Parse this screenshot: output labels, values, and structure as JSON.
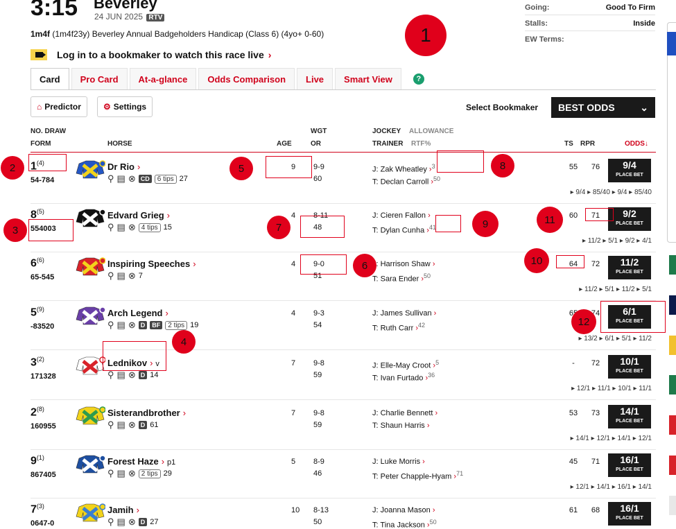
{
  "race": {
    "time": "3:15",
    "course": "Beverley",
    "date": "24 JUN 2025",
    "rtv": "RTV",
    "distance": "1m4f",
    "detail": " (1m4f23y) Beverley Annual Badgeholders Handicap (Class 6) (4yo+ 0-60)",
    "watch_text": "Log in to a bookmaker to watch this race live",
    "going_label": "Going:",
    "going_value": "Good To Firm",
    "stalls_label": "Stalls:",
    "stalls_value": "Inside",
    "ew_label": "EW Terms:",
    "chevron": "›"
  },
  "tabs": [
    "Card",
    "Pro Card",
    "At-a-glance",
    "Odds Comparison",
    "Live",
    "Smart View"
  ],
  "help": "?",
  "toolbar": {
    "predictor": "Predictor",
    "settings": "Settings",
    "select_label": "Select Bookmaker",
    "bookmaker": "BEST ODDS"
  },
  "columns": {
    "no_draw": "NO.  DRAW",
    "form": "FORM",
    "horse": "HORSE",
    "age": "AGE",
    "wgt": "WGT",
    "or": "OR",
    "jockey": "JOCKEY",
    "allowance": "ALLOWANCE",
    "trainer": "TRAINER",
    "rtf": "RTF%",
    "ts": "TS",
    "rpr": "RPR",
    "odds": "ODDS↓"
  },
  "place_bet": "PLACE BET",
  "runners": [
    {
      "no": "1",
      "draw": "(4)",
      "form": "54-784",
      "horse": "Dr Rio",
      "headgear": "",
      "badges": [
        "CD"
      ],
      "tips": "6 tips",
      "days": "27",
      "age": "9",
      "wgt": "9-9",
      "or": "60",
      "jockey": "J: Zak Wheatley",
      "allow": "3",
      "trainer": "T: Declan Carroll",
      "rtf": "50",
      "ts": "55",
      "rpr": "76",
      "odds": "9/4",
      "hist": "▸ 9/4  ▸ 85/40  ▸ 9/4  ▸ 85/40",
      "silk": [
        "#2457c5",
        "#f2d31b"
      ]
    },
    {
      "no": "8",
      "draw": "(5)",
      "form": "554003",
      "horse": "Edvard Grieg",
      "headgear": "",
      "badges": [],
      "tips": "4 tips",
      "days": "15",
      "age": "4",
      "wgt": "8-11",
      "or": "48",
      "jockey": "J: Cieren Fallon",
      "allow": "",
      "trainer": "T: Dylan Cunha",
      "rtf": "41",
      "ts": "60",
      "rpr": "71",
      "odds": "9/2",
      "hist": "▸ 11/2  ▸ 5/1  ▸ 9/2  ▸ 4/1",
      "silk": [
        "#111111",
        "#ffffff"
      ]
    },
    {
      "no": "6",
      "draw": "(6)",
      "form": "65-545",
      "horse": "Inspiring Speeches",
      "headgear": "",
      "badges": [],
      "tips": "",
      "days": "7",
      "age": "4",
      "wgt": "9-0",
      "or": "51",
      "jockey": "J: Harrison Shaw",
      "allow": "",
      "trainer": "T: Sara Ender",
      "rtf": "50",
      "ts": "64",
      "rpr": "72",
      "odds": "11/2",
      "hist": "▸ 11/2  ▸ 5/1  ▸ 11/2  ▸ 5/1",
      "silk": [
        "#d8232a",
        "#f2d31b"
      ]
    },
    {
      "no": "5",
      "draw": "(9)",
      "form": "-83520",
      "horse": "Arch Legend",
      "headgear": "",
      "badges": [
        "D",
        "BF"
      ],
      "tips": "2 tips",
      "days": "19",
      "age": "4",
      "wgt": "9-3",
      "or": "54",
      "jockey": "J: James Sullivan",
      "allow": "",
      "trainer": "T: Ruth Carr",
      "rtf": "42",
      "ts": "65",
      "rpr": "74",
      "odds": "6/1",
      "hist": "▸ 13/2  ▸ 6/1  ▸ 5/1  ▸ 11/2",
      "silk": [
        "#6a3fa8",
        "#ffffff"
      ]
    },
    {
      "no": "3",
      "draw": "(2)",
      "form": "171328",
      "horse": "Lednikov",
      "headgear": "v",
      "badges": [
        "D"
      ],
      "tips": "",
      "days": "14",
      "age": "7",
      "wgt": "9-8",
      "or": "59",
      "jockey": "J: Elle-May Croot",
      "allow": "5",
      "trainer": "T: Ivan Furtado",
      "rtf": "36",
      "ts": "-",
      "rpr": "72",
      "odds": "10/1",
      "hist": "▸ 12/1  ▸ 11/1  ▸ 10/1  ▸ 11/1",
      "silk": [
        "#ffffff",
        "#d8232a"
      ]
    },
    {
      "no": "2",
      "draw": "(8)",
      "form": "160955",
      "horse": "Sisterandbrother",
      "headgear": "",
      "badges": [
        "D"
      ],
      "tips": "",
      "days": "61",
      "age": "7",
      "wgt": "9-8",
      "or": "59",
      "jockey": "J: Charlie Bennett",
      "allow": "",
      "trainer": "T: Shaun Harris",
      "rtf": "",
      "ts": "53",
      "rpr": "73",
      "odds": "14/1",
      "hist": "▸ 14/1  ▸ 12/1  ▸ 14/1  ▸ 12/1",
      "silk": [
        "#f2d31b",
        "#2e9b4f"
      ]
    },
    {
      "no": "9",
      "draw": "(1)",
      "form": "867405",
      "horse": "Forest Haze",
      "headgear": "p1",
      "badges": [],
      "tips": "2 tips",
      "days": "29",
      "age": "5",
      "wgt": "8-9",
      "or": "46",
      "jockey": "J: Luke Morris",
      "allow": "",
      "trainer": "T: Peter Chapple-Hyam",
      "rtf": "71",
      "ts": "45",
      "rpr": "71",
      "odds": "16/1",
      "hist": "▸ 12/1  ▸ 14/1  ▸ 16/1  ▸ 14/1",
      "silk": [
        "#1e4fa0",
        "#ffffff"
      ]
    },
    {
      "no": "7",
      "draw": "(3)",
      "form": "0647-0",
      "horse": "Jamih",
      "headgear": "",
      "badges": [
        "D"
      ],
      "tips": "",
      "days": "27",
      "age": "10",
      "wgt": "8-13",
      "or": "50",
      "jockey": "J: Joanna Mason",
      "allow": "",
      "trainer": "T: Tina Jackson",
      "rtf": "50",
      "ts": "61",
      "rpr": "68",
      "odds": "16/1",
      "hist": "",
      "silk": [
        "#f2d31b",
        "#3a7fd0"
      ]
    }
  ],
  "markers": [
    "1",
    "2",
    "3",
    "4",
    "5",
    "6",
    "7",
    "8",
    "9",
    "10",
    "11",
    "12"
  ],
  "colors": {
    "accent_red": "#d0021b",
    "dark": "#1a1a1a",
    "marker": "#e0001b",
    "video_yellow": "#f6d24b"
  }
}
